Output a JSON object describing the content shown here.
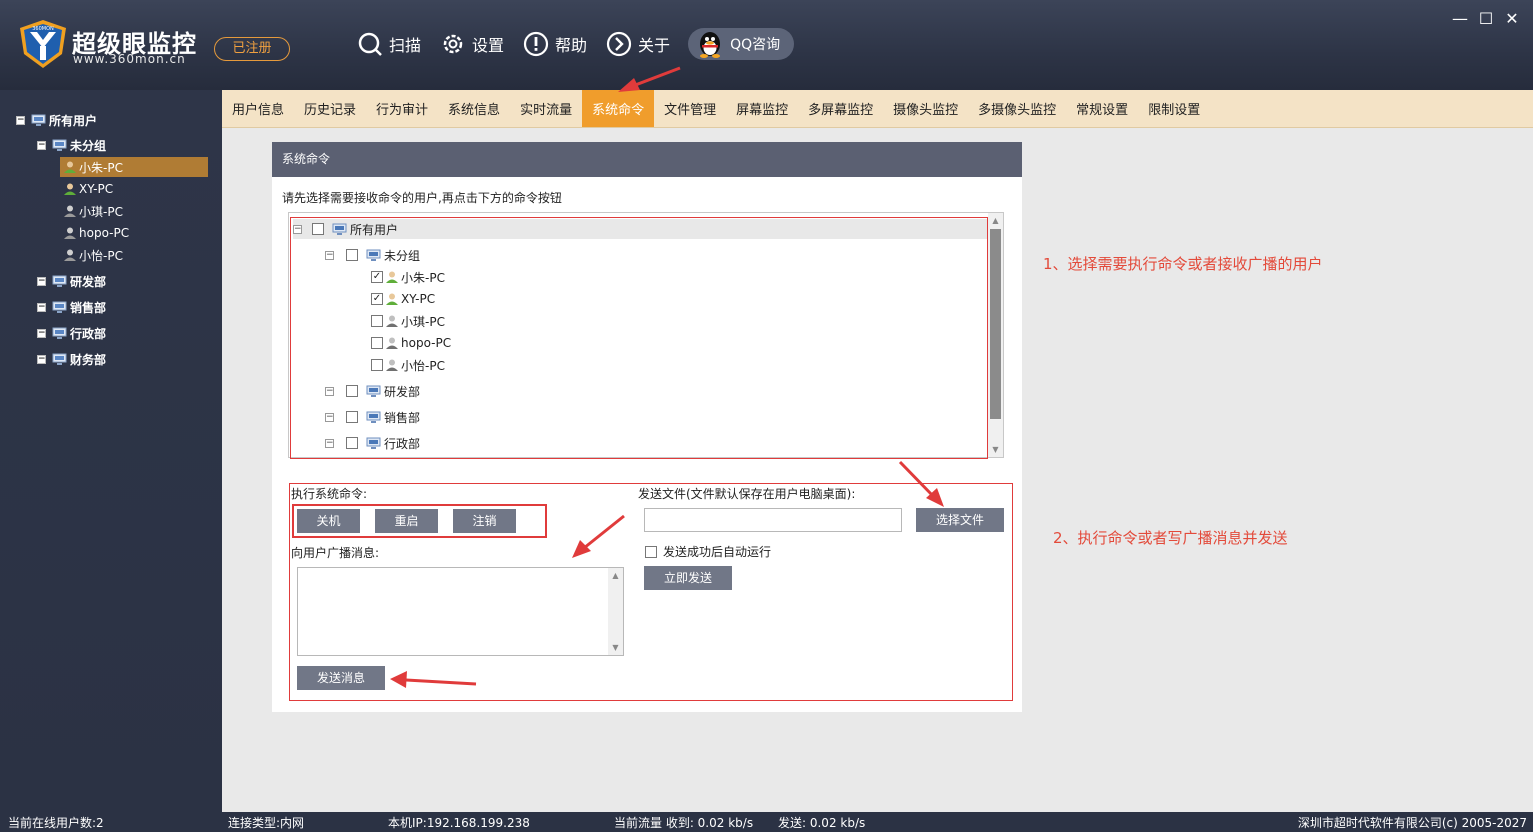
{
  "app": {
    "title": "超级眼监控",
    "url": "www.360mon.cn",
    "registered": "已注册",
    "logo_badge_text": "360MON"
  },
  "top_nav": [
    {
      "label": "扫描",
      "icon": "search-icon"
    },
    {
      "label": "设置",
      "icon": "gear-icon"
    },
    {
      "label": "帮助",
      "icon": "help-icon"
    },
    {
      "label": "关于",
      "icon": "about-icon"
    }
  ],
  "qq": {
    "label": "QQ咨询",
    "icon": "qq-penguin-icon"
  },
  "window_controls": {
    "minimize": "—",
    "maximize": "☐",
    "close": "✕"
  },
  "sidebar": {
    "root": "所有用户",
    "groups": [
      {
        "label": "未分组",
        "users": [
          "小朱-PC",
          "XY-PC",
          "小琪-PC",
          "hopo-PC",
          "小怡-PC"
        ],
        "selected": "小朱-PC"
      },
      {
        "label": "研发部"
      },
      {
        "label": "销售部"
      },
      {
        "label": "行政部"
      },
      {
        "label": "财务部"
      }
    ]
  },
  "tabs": [
    {
      "label": "用户信息"
    },
    {
      "label": "历史记录"
    },
    {
      "label": "行为审计"
    },
    {
      "label": "系统信息"
    },
    {
      "label": "实时流量"
    },
    {
      "label": "系统命令",
      "active": true
    },
    {
      "label": "文件管理"
    },
    {
      "label": "屏幕监控"
    },
    {
      "label": "多屏幕监控"
    },
    {
      "label": "摄像头监控"
    },
    {
      "label": "多摄像头监控"
    },
    {
      "label": "常规设置"
    },
    {
      "label": "限制设置"
    }
  ],
  "panel": {
    "title": "系统命令",
    "instruction": "请先选择需要接收命令的用户,再点击下方的命令按钮",
    "tree": {
      "root": "所有用户",
      "group": "未分组",
      "users": [
        {
          "label": "小朱-PC",
          "checked": true
        },
        {
          "label": "XY-PC",
          "checked": true
        },
        {
          "label": "小琪-PC",
          "checked": false
        },
        {
          "label": "hopo-PC",
          "checked": false
        },
        {
          "label": "小怡-PC",
          "checked": false
        }
      ],
      "other_groups": [
        "研发部",
        "销售部",
        "行政部"
      ]
    },
    "exec_label": "执行系统命令:",
    "buttons": {
      "shutdown": "关机",
      "restart": "重启",
      "logout": "注销"
    },
    "broadcast_label": "向用户广播消息:",
    "broadcast_value": "",
    "send_message": "发送消息",
    "send_file_label": "发送文件(文件默认保存在用户电脑桌面):",
    "file_path_value": "",
    "choose_file": "选择文件",
    "auto_run_label": "发送成功后自动运行",
    "auto_run_checked": false,
    "send_now": "立即发送"
  },
  "annotations": {
    "step1": "1、选择需要执行命令或者接收广播的用户",
    "step2": "2、执行命令或者写广播消息并发送"
  },
  "status": {
    "online": "当前在线用户数:2",
    "conn": "连接类型:内网",
    "ip": "本机IP:192.168.199.238",
    "traffic_in": "当前流量 收到: 0.02 kb/s",
    "traffic_out": "发送: 0.02 kb/s",
    "company": "深圳市超时代软件有限公司(c) 2005-2027"
  },
  "colors": {
    "accent_orange": "#f09d2c",
    "annotation_red": "#e03b3b",
    "sidebar_bg": "#2b3244",
    "button_gray": "#717787"
  }
}
